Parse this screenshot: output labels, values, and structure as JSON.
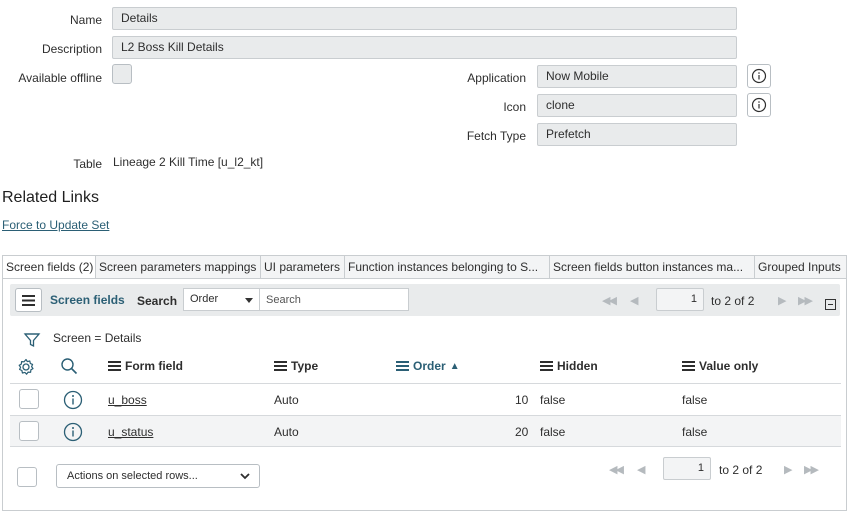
{
  "form": {
    "name_label": "Name",
    "name_value": "Details",
    "description_label": "Description",
    "description_value": "L2 Boss Kill Details",
    "available_offline_label": "Available offline",
    "application_label": "Application",
    "application_value": "Now Mobile",
    "icon_label": "Icon",
    "icon_value": "clone",
    "fetch_type_label": "Fetch Type",
    "fetch_type_value": "Prefetch",
    "table_label": "Table",
    "table_value": "Lineage 2 Kill Time [u_l2_kt]"
  },
  "related_links": {
    "heading": "Related Links",
    "force_update_link": "Force to Update Set"
  },
  "tabs": [
    {
      "label": "Screen fields (2)",
      "active": true
    },
    {
      "label": "Screen parameters mappings"
    },
    {
      "label": "UI parameters"
    },
    {
      "label": "Function instances belonging to S..."
    },
    {
      "label": "Screen fields button instances ma..."
    },
    {
      "label": "Grouped Inputs"
    }
  ],
  "list": {
    "title": "Screen fields",
    "search_label": "Search",
    "search_field_selected": "Order",
    "search_placeholder": "Search",
    "page_number": "1",
    "page_range": "to 2 of 2",
    "filter_text": "Screen = Details",
    "columns": [
      "Form field",
      "Type",
      "Order",
      "Hidden",
      "Value only"
    ],
    "sort_indicator": "▲",
    "rows": [
      {
        "form_field": "u_boss",
        "type": "Auto",
        "order": "10",
        "hidden": "false",
        "value_only": "false"
      },
      {
        "form_field": "u_status",
        "type": "Auto",
        "order": "20",
        "hidden": "false",
        "value_only": "false"
      }
    ],
    "actions_label": "Actions on selected rows..."
  },
  "colors": {
    "accent": "#2b5f75",
    "field_bg": "#e9ebec",
    "border": "#c9cdd0"
  },
  "icons": {
    "menu": "hamburger-icon",
    "filter": "filter-funnel-icon",
    "settings": "gear-icon",
    "search": "search-icon",
    "info": "info-icon",
    "first": "first-page-icon",
    "prev": "prev-page-icon",
    "next": "next-page-icon",
    "last": "last-page-icon",
    "collapse": "collapse-icon",
    "chevron": "chevron-down-icon"
  }
}
